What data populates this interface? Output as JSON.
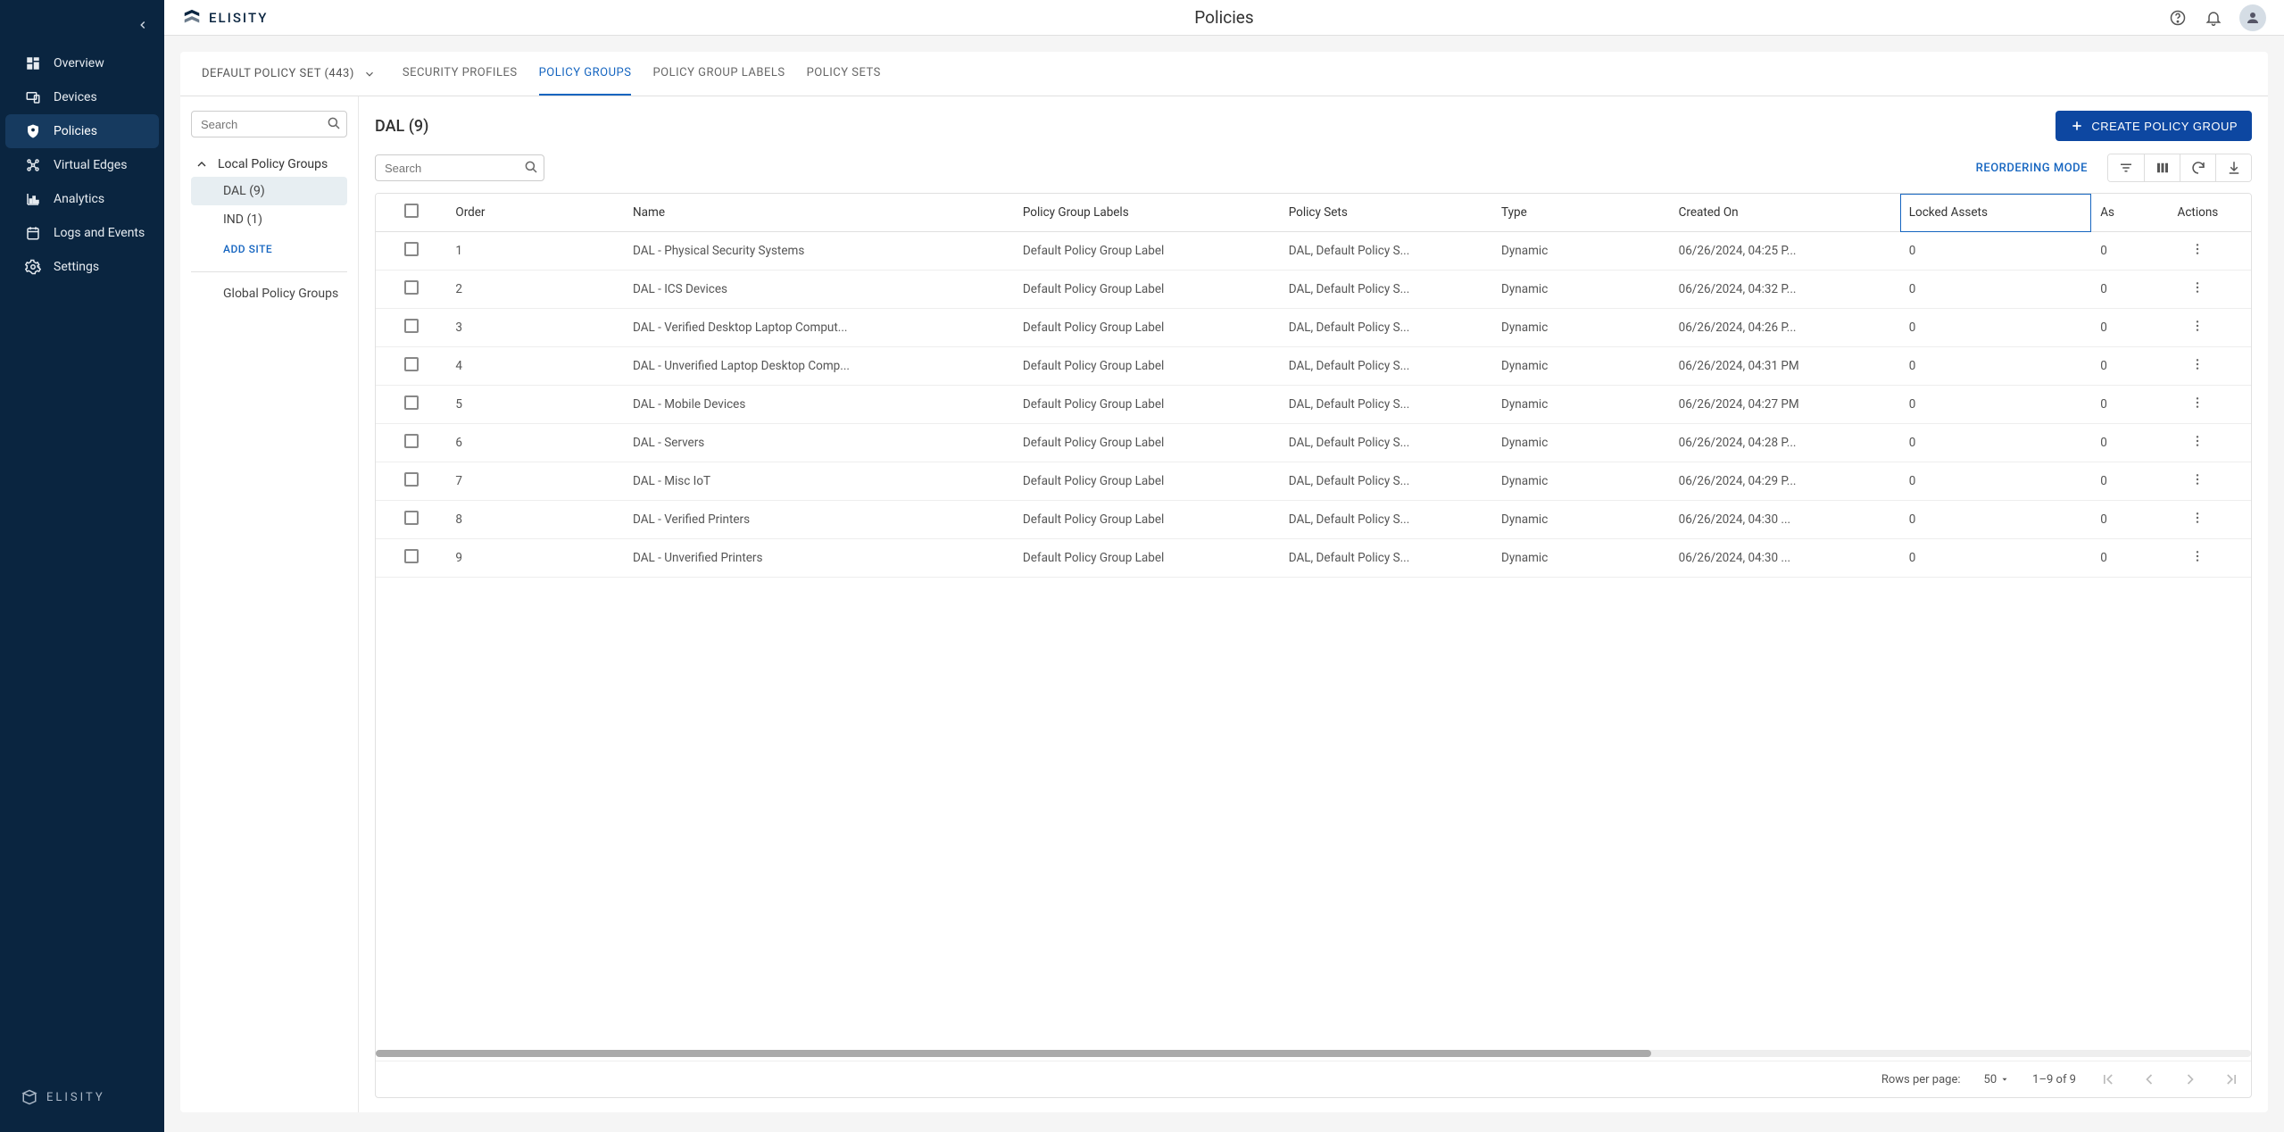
{
  "brand": "ELISITY",
  "header": {
    "title": "Policies"
  },
  "sidebar": {
    "items": [
      {
        "label": "Overview",
        "icon": "dashboard"
      },
      {
        "label": "Devices",
        "icon": "devices"
      },
      {
        "label": "Policies",
        "icon": "shield",
        "active": true
      },
      {
        "label": "Virtual Edges",
        "icon": "graph"
      },
      {
        "label": "Analytics",
        "icon": "chart"
      },
      {
        "label": "Logs and Events",
        "icon": "calendar"
      },
      {
        "label": "Settings",
        "icon": "gear"
      }
    ]
  },
  "policySetSelector": "DEFAULT POLICY SET (443)",
  "tabs": [
    {
      "label": "SECURITY PROFILES"
    },
    {
      "label": "POLICY GROUPS",
      "active": true
    },
    {
      "label": "POLICY GROUP LABELS"
    },
    {
      "label": "POLICY SETS"
    }
  ],
  "leftPane": {
    "searchPlaceholder": "Search",
    "localHeader": "Local Policy Groups",
    "items": [
      {
        "label": "DAL (9)",
        "selected": true
      },
      {
        "label": "IND (1)"
      }
    ],
    "addSite": "ADD SITE",
    "globalHeader": "Global Policy Groups"
  },
  "rightPane": {
    "title": "DAL (9)",
    "createBtn": "CREATE POLICY GROUP",
    "searchPlaceholder": "Search",
    "reorder": "REORDERING MODE",
    "columns": [
      "Order",
      "Name",
      "Policy Group Labels",
      "Policy Sets",
      "Type",
      "Created On",
      "Locked Assets",
      "As",
      "Actions"
    ],
    "rows": [
      {
        "order": "1",
        "name": "DAL - Physical Security Systems",
        "labels": "Default Policy Group Label",
        "sets": "DAL, Default Policy S...",
        "type": "Dynamic",
        "created": "06/26/2024, 04:25 P...",
        "locked": "0",
        "as": "0"
      },
      {
        "order": "2",
        "name": "DAL - ICS Devices",
        "labels": "Default Policy Group Label",
        "sets": "DAL, Default Policy S...",
        "type": "Dynamic",
        "created": "06/26/2024, 04:32 P...",
        "locked": "0",
        "as": "0"
      },
      {
        "order": "3",
        "name": "DAL - Verified Desktop Laptop Comput...",
        "labels": "Default Policy Group Label",
        "sets": "DAL, Default Policy S...",
        "type": "Dynamic",
        "created": "06/26/2024, 04:26 P...",
        "locked": "0",
        "as": "0"
      },
      {
        "order": "4",
        "name": "DAL - Unverified Laptop Desktop Comp...",
        "labels": "Default Policy Group Label",
        "sets": "DAL, Default Policy S...",
        "type": "Dynamic",
        "created": "06/26/2024, 04:31 PM",
        "locked": "0",
        "as": "0"
      },
      {
        "order": "5",
        "name": "DAL - Mobile Devices",
        "labels": "Default Policy Group Label",
        "sets": "DAL, Default Policy S...",
        "type": "Dynamic",
        "created": "06/26/2024, 04:27 PM",
        "locked": "0",
        "as": "0"
      },
      {
        "order": "6",
        "name": "DAL - Servers",
        "labels": "Default Policy Group Label",
        "sets": "DAL, Default Policy S...",
        "type": "Dynamic",
        "created": "06/26/2024, 04:28 P...",
        "locked": "0",
        "as": "0"
      },
      {
        "order": "7",
        "name": "DAL - Misc IoT",
        "labels": "Default Policy Group Label",
        "sets": "DAL, Default Policy S...",
        "type": "Dynamic",
        "created": "06/26/2024, 04:29 P...",
        "locked": "0",
        "as": "0"
      },
      {
        "order": "8",
        "name": "DAL - Verified Printers",
        "labels": "Default Policy Group Label",
        "sets": "DAL, Default Policy S...",
        "type": "Dynamic",
        "created": "06/26/2024, 04:30 ...",
        "locked": "0",
        "as": "0"
      },
      {
        "order": "9",
        "name": "DAL - Unverified Printers",
        "labels": "Default Policy Group Label",
        "sets": "DAL, Default Policy S...",
        "type": "Dynamic",
        "created": "06/26/2024, 04:30 ...",
        "locked": "0",
        "as": "0"
      }
    ],
    "pagination": {
      "rowsPerPageLabel": "Rows per page:",
      "rowsPerPageValue": "50",
      "range": "1–9 of 9"
    }
  }
}
